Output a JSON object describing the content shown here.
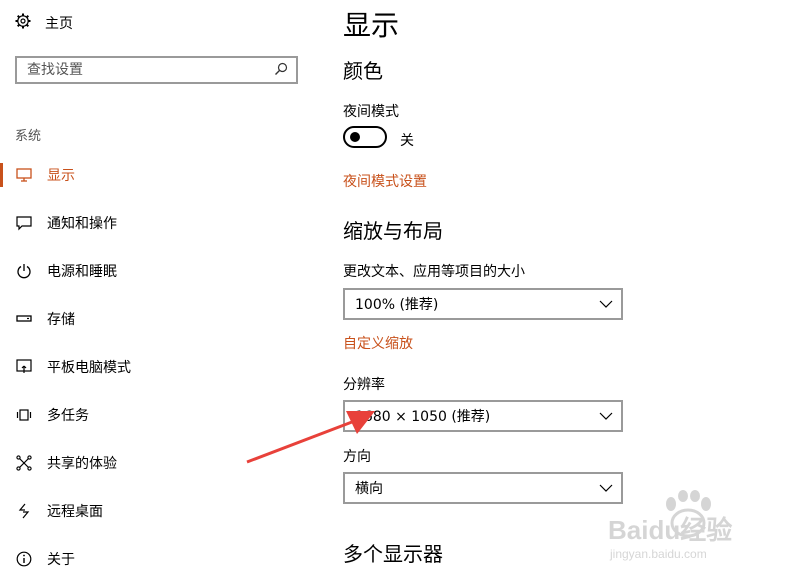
{
  "sidebar": {
    "home_label": "主页",
    "search_placeholder": "查找设置",
    "section_label": "系统",
    "items": [
      {
        "label": "显示",
        "icon": "monitor-icon",
        "active": true
      },
      {
        "label": "通知和操作",
        "icon": "message-icon",
        "active": false
      },
      {
        "label": "电源和睡眠",
        "icon": "power-icon",
        "active": false
      },
      {
        "label": "存储",
        "icon": "storage-icon",
        "active": false
      },
      {
        "label": "平板电脑模式",
        "icon": "tablet-mode-icon",
        "active": false
      },
      {
        "label": "多任务",
        "icon": "multitask-icon",
        "active": false
      },
      {
        "label": "共享的体验",
        "icon": "share-icon",
        "active": false
      },
      {
        "label": "远程桌面",
        "icon": "remote-desktop-icon",
        "active": false
      },
      {
        "label": "关于",
        "icon": "info-icon",
        "active": false
      }
    ]
  },
  "main": {
    "title": "显示",
    "color_section": {
      "heading": "颜色",
      "night_mode_label": "夜间模式",
      "night_mode_state": "关",
      "night_mode_on": false,
      "night_mode_settings_link": "夜间模式设置"
    },
    "scale_section": {
      "heading": "缩放与布局",
      "text_size_label": "更改文本、应用等项目的大小",
      "text_size_value": "100% (推荐)",
      "custom_scale_link": "自定义缩放",
      "resolution_label": "分辨率",
      "resolution_value": "1680 × 1050 (推荐)",
      "orientation_label": "方向",
      "orientation_value": "横向"
    },
    "multi_display_heading": "多个显示器"
  },
  "watermark": {
    "brand": "Baidu经验",
    "url": "jingyan.baidu.com"
  },
  "colors": {
    "accent": "#c8511b",
    "annotation_arrow": "#e8413a"
  }
}
